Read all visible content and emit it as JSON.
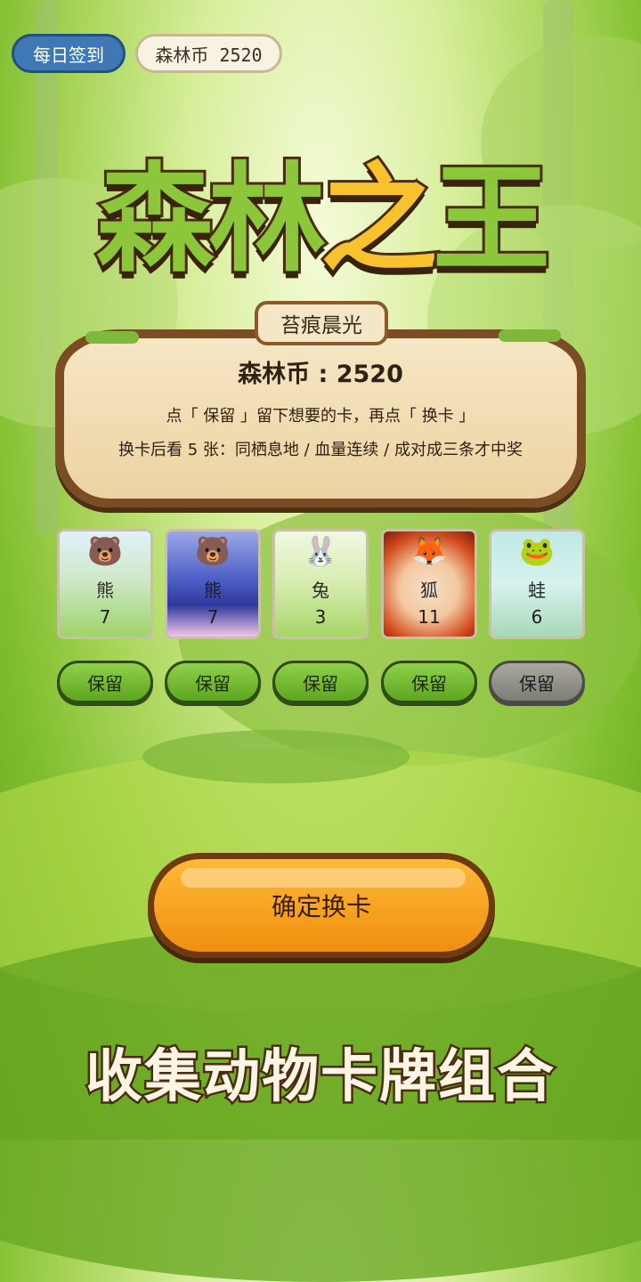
{
  "top_bar": {
    "checkin_label": "每日签到",
    "coins_label": "森林币 2520"
  },
  "logo": {
    "part1": "森林",
    "part2": "之",
    "part3": "王"
  },
  "panel": {
    "tab_title": "苔痕晨光",
    "coins_text": "森林币 : 2520",
    "instruction_1": "点「 保留 」留下想要的卡，再点「 换卡 」",
    "instruction_2": "换卡后看 5 张：同栖息地 / 血量连续 / 成对成三条才中奖"
  },
  "cards": [
    {
      "icon": "bear-icon",
      "emoji": "🐻",
      "name": "熊",
      "value": "7",
      "keep": "保留",
      "kept": true,
      "bg": "meadow"
    },
    {
      "icon": "bear-icon",
      "emoji": "🐻",
      "name": "熊",
      "value": "7",
      "keep": "保留",
      "kept": true,
      "bg": "lake"
    },
    {
      "icon": "rabbit-icon",
      "emoji": "🐰",
      "name": "兔",
      "value": "3",
      "keep": "保留",
      "kept": true,
      "bg": "meadow"
    },
    {
      "icon": "fox-icon",
      "emoji": "🦊",
      "name": "狐",
      "value": "11",
      "keep": "保留",
      "kept": true,
      "bg": "volcano"
    },
    {
      "icon": "frog-icon",
      "emoji": "🐸",
      "name": "蛙",
      "value": "6",
      "keep": "保留",
      "kept": false,
      "bg": "pond"
    }
  ],
  "confirm_label": "确定换卡",
  "slogan": "收集动物卡牌组合",
  "colors": {
    "keep_on": "#6bb42a",
    "keep_off": "#8e8e86",
    "confirm": "#f5a020",
    "wood": "#7a4d25"
  }
}
